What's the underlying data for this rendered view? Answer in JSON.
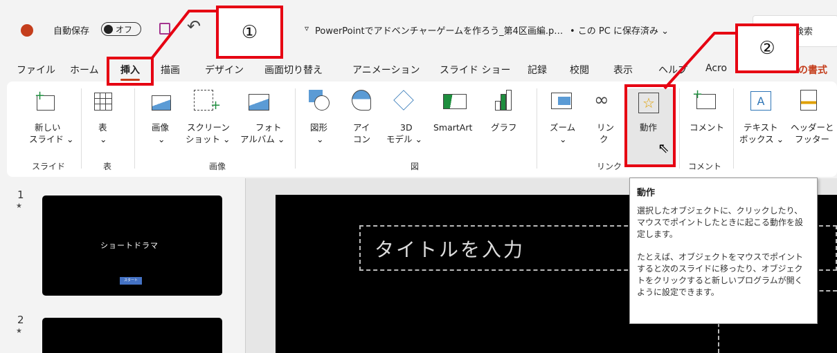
{
  "titlebar": {
    "autosave_label": "自動保存",
    "toggle_label": "オフ",
    "doc_title": "PowerPointでアドベンチャーゲームを作ろう_第4区画編.p…",
    "save_status": "• この PC に保存済み ⌄",
    "search_placeholder": "検索"
  },
  "menu": {
    "tabs": [
      "ファイル",
      "ホーム",
      "挿入",
      "描画",
      "デザイン",
      "画面切り替え",
      "アニメーション",
      "スライド ショー",
      "記録",
      "校閲",
      "表示",
      "ヘルプ",
      "Acro",
      "の書式"
    ],
    "active_tab": "挿入"
  },
  "ribbon": {
    "new_slide": [
      "新しい",
      "スライド ⌄"
    ],
    "table": [
      "表",
      "⌄"
    ],
    "image": [
      "画像",
      "⌄"
    ],
    "screenshot": [
      "スクリーン",
      "ショット ⌄"
    ],
    "photo_album": [
      "フォト",
      "アルバム ⌄"
    ],
    "shapes": [
      "図形",
      "⌄"
    ],
    "icons": [
      "アイ",
      "コン"
    ],
    "model3d": [
      "3D",
      "モデル ⌄"
    ],
    "smartart": "SmartArt",
    "graph": "グラフ",
    "zoom": [
      "ズーム",
      "⌄"
    ],
    "link": [
      "リン",
      "ク"
    ],
    "action": "動作",
    "comment": "コメント",
    "textbox": [
      "テキスト",
      "ボックス ⌄"
    ],
    "header_footer": [
      "ヘッダーと",
      "フッター"
    ],
    "groups": {
      "slide": "スライド",
      "table": "表",
      "images": "画像",
      "figure": "図",
      "link": "リンク",
      "comment": "コメント"
    }
  },
  "annotations": {
    "callout1": "①",
    "callout2": "②",
    "accent": "#e60012"
  },
  "slides": [
    {
      "number": "1",
      "star": "★",
      "title": "ショートドラマ",
      "button": "スタート"
    },
    {
      "number": "2",
      "star": "★"
    }
  ],
  "editor": {
    "title_placeholder": "タイトルを入力"
  },
  "tooltip": {
    "title": "動作",
    "para1": "選択したオブジェクトに、クリックしたり、マウスでポイントしたときに起こる動作を設定します。",
    "para2": "たとえば、オブジェクトをマウスでポイントすると次のスライドに移ったり、オブジェクトをクリックすると新しいプログラムが開くように設定できます。"
  }
}
